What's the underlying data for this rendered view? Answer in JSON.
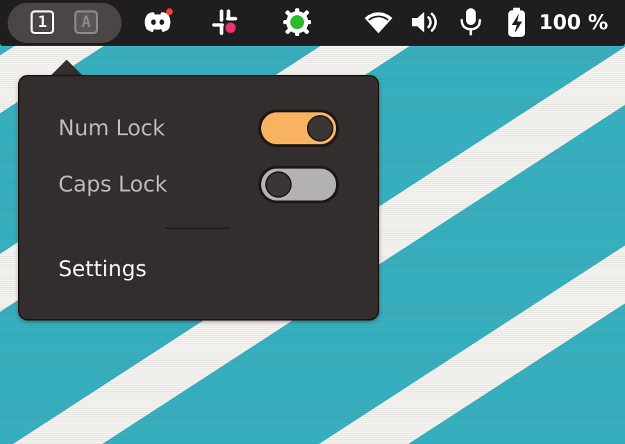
{
  "top_bar": {
    "keyboard_indicator": {
      "num_lock_badge": "1",
      "caps_lock_badge": "A"
    },
    "tray_icons": [
      "discord-icon",
      "slack-icon",
      "status-indicator-icon",
      "wifi-icon",
      "volume-icon",
      "microphone-icon",
      "battery-charging-icon"
    ],
    "battery_percent": "100 %"
  },
  "popover": {
    "num_lock": {
      "label": "Num Lock",
      "enabled": true
    },
    "caps_lock": {
      "label": "Caps Lock",
      "enabled": false
    },
    "settings_label": "Settings"
  },
  "colors": {
    "toggle_on": "#f8b260",
    "toggle_off": "#b3b1b1",
    "discord_notification": "#e8453c",
    "status_green": "#2db82d",
    "slack_pink": "#e8356f"
  }
}
